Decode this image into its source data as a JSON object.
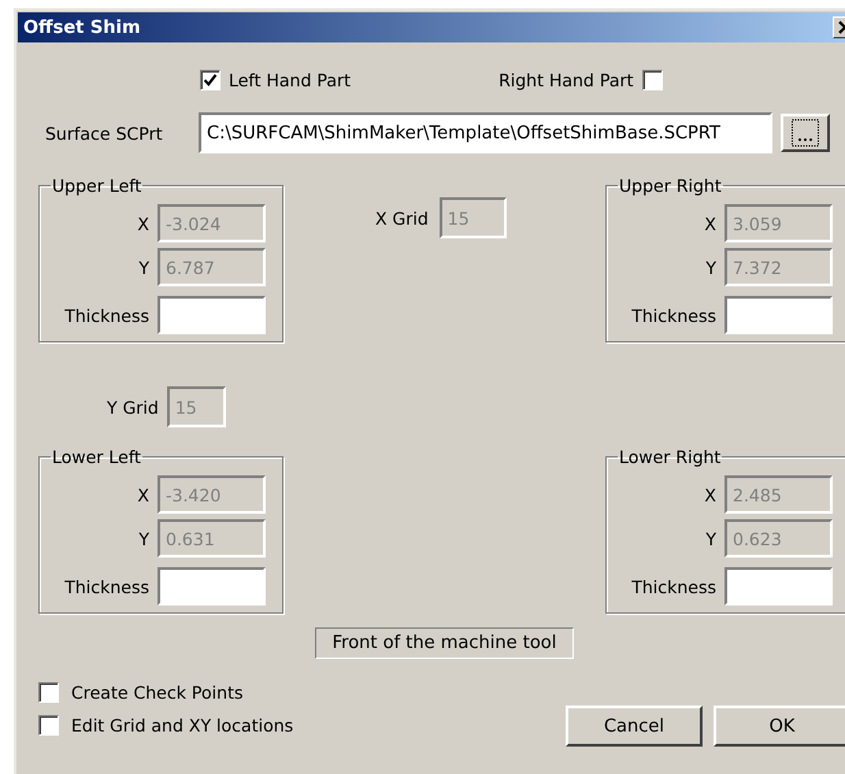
{
  "window": {
    "title": "Offset Shim"
  },
  "hand_options": [
    {
      "label": "Left Hand Part",
      "checked": true,
      "kind": "box-first"
    },
    {
      "label": "Right Hand Part",
      "checked": false,
      "kind": "box-last"
    }
  ],
  "surface": {
    "label": "Surface SCPrt",
    "value": "C:\\SURFCAM\\ShimMaker\\Template\\OffsetShimBase.SCPRT"
  },
  "groups": [
    {
      "title": "Upper Left",
      "fields": [
        {
          "label": "X",
          "value": "-3.024",
          "disabled": true
        },
        {
          "label": "Y",
          "value": "6.787",
          "disabled": true
        },
        {
          "label": "Thickness",
          "disabled": false
        }
      ]
    },
    {
      "title": "Upper Right",
      "fields": [
        {
          "label": "X",
          "value": "3.059",
          "disabled": true
        },
        {
          "label": "Y",
          "value": "7.372",
          "disabled": true
        },
        {
          "label": "Thickness",
          "disabled": false
        }
      ]
    },
    {
      "title": "Lower Left",
      "fields": [
        {
          "label": "X",
          "value": "-3.420",
          "disabled": true
        },
        {
          "label": "Y",
          "value": "0.631",
          "disabled": true
        },
        {
          "label": "Thickness",
          "disabled": false
        }
      ]
    },
    {
      "title": "Lower Right",
      "fields": [
        {
          "label": "X",
          "value": "2.485",
          "disabled": true
        },
        {
          "label": "Y",
          "value": "0.623",
          "disabled": true
        },
        {
          "label": "Thickness",
          "disabled": false
        }
      ]
    }
  ],
  "x_grid": {
    "label": "X Grid",
    "value": "15",
    "disabled": true
  },
  "y_grid": {
    "label": "Y Grid",
    "value": "15",
    "disabled": true
  },
  "front_label": "Front of the machine tool",
  "options": [
    {
      "label": "Create Check Points",
      "checked": false
    },
    {
      "label": "Edit Grid and XY locations",
      "checked": false
    }
  ],
  "buttons": [
    "Cancel",
    "OK"
  ]
}
